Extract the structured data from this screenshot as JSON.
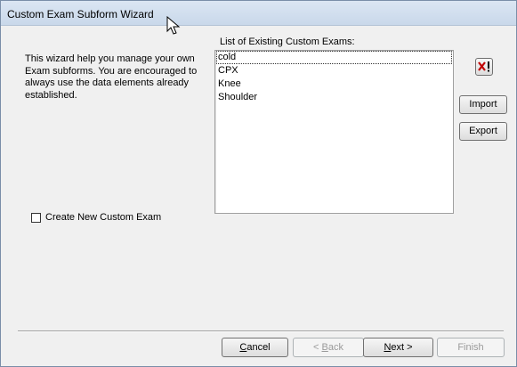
{
  "window": {
    "title": "Custom Exam Subform Wizard"
  },
  "intro_text": "This wizard help you manage your own\nExam subforms.  You are encouraged to\nalways use the data elements already\nestablished.",
  "exam_list": {
    "label": "List of Existing Custom Exams:",
    "items": [
      "cold",
      "CPX",
      "Knee",
      "Shoulder"
    ],
    "selected_index": 0
  },
  "side_buttons": {
    "delete_icon": "delete-x-icon",
    "import_label": "Import",
    "export_label": "Export"
  },
  "create_new": {
    "label": "Create New Custom Exam",
    "checked": false
  },
  "nav_buttons": {
    "cancel_accel": "C",
    "cancel_rest": "ancel",
    "back_prefix": "< ",
    "back_accel": "B",
    "back_rest": "ack",
    "next_accel": "N",
    "next_rest": "ext >",
    "finish_label": "Finish"
  }
}
